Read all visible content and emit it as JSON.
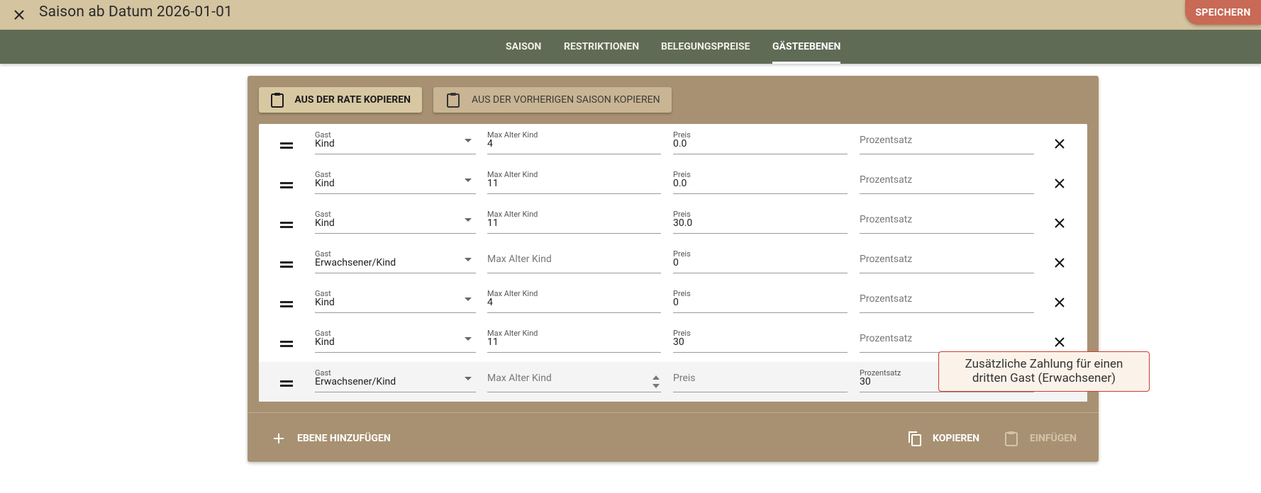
{
  "header": {
    "title": "Saison ab Datum 2026-01-01",
    "save_label": "SPEICHERN",
    "close_icon": "close-icon"
  },
  "tabs": [
    {
      "label": "SAISON",
      "active": false
    },
    {
      "label": "RESTRIKTIONEN",
      "active": false
    },
    {
      "label": "BELEGUNGSPREISE",
      "active": false
    },
    {
      "label": "GÄSTEEBENEN",
      "active": true
    }
  ],
  "toolbar": {
    "copy_from_rate": "AUS DER RATE KOPIEREN",
    "copy_from_previous": "AUS DER VORHERIGEN SAISON KOPIEREN"
  },
  "labels": {
    "gast": "Gast",
    "max_age": "Max Alter Kind",
    "preis": "Preis",
    "prozentsatz": "Prozentsatz"
  },
  "rows": [
    {
      "gast": "Kind",
      "max_age": "4",
      "preis": "0.0",
      "prozentsatz": ""
    },
    {
      "gast": "Kind",
      "max_age": "11",
      "preis": "0.0",
      "prozentsatz": ""
    },
    {
      "gast": "Kind",
      "max_age": "11",
      "preis": "30.0",
      "prozentsatz": ""
    },
    {
      "gast": "Erwachsener/Kind",
      "max_age": "",
      "preis": "0",
      "prozentsatz": ""
    },
    {
      "gast": "Kind",
      "max_age": "4",
      "preis": "0",
      "prozentsatz": ""
    },
    {
      "gast": "Kind",
      "max_age": "11",
      "preis": "30",
      "prozentsatz": ""
    },
    {
      "gast": "Erwachsener/Kind",
      "max_age": "",
      "preis": "",
      "prozentsatz": "30"
    }
  ],
  "footer": {
    "add_level": "EBENE HINZUFÜGEN",
    "copy": "KOPIEREN",
    "paste": "EINFÜGEN"
  },
  "tooltip": {
    "line1": "Zusätzliche Zahlung für einen",
    "line2": "dritten Gast (Erwachsener)"
  },
  "colors": {
    "header_bg": "#d4c4a0",
    "tabs_bg": "#606b55",
    "card_bg": "#a89172",
    "save_button": "#c86a55",
    "tooltip_border": "#d03a2f"
  }
}
